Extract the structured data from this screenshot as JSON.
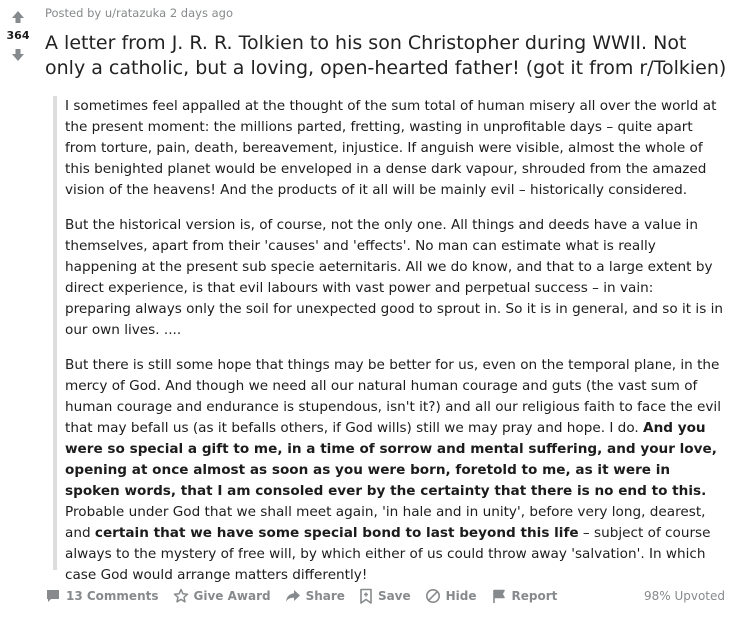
{
  "vote": {
    "count": "364"
  },
  "meta": {
    "posted_by": "Posted by u/ratazuka 2 days ago"
  },
  "post": {
    "title": "A letter from J. R. R. Tolkien to his son Christopher during WWII. Not only a catholic, but a loving, open-hearted father! (got it from r/Tolkien)",
    "paragraphs": [
      "I sometimes feel appalled at the thought of the sum total of human misery all over the world at the present moment: the millions parted, fretting, wasting in unprofitable days – quite apart from torture, pain, death, bereavement, injustice. If anguish were visible, almost the whole of this benighted planet would be enveloped in a dense dark vapour, shrouded from the amazed vision of the heavens! And the products of it all will be mainly evil – historically considered.",
      "But the historical version is, of course, not the only one. All things and deeds have a value in themselves, apart from their 'causes' and 'effects'. No man can estimate what is really happening at the present sub specie aeternitaris. All we do know, and that to a large extent by direct experience, is that evil labours with vast power and perpetual success – in vain: preparing always only the soil for unexpected good to sprout in. So it is in general, and so it is in our own lives. ...."
    ],
    "para3": {
      "part1": "But there is still some hope that things may be better for us, even on the temporal plane, in the mercy of God. And though we need all our natural human courage and guts (the vast sum of human courage and endurance is stupendous, isn't it?) and all our religious faith to face the evil that may befall us (as it befalls others, if God wills) still we may pray and hope. I do. ",
      "bold1": "And you were so special a gift to me, in a time of sorrow and mental suffering, and your love, opening at once almost as soon as you were born, foretold to me, as it were in spoken words, that I am consoled ever by the certainty that there is no end to this.",
      "part2": " Probable under God that we shall meet again, 'in hale and in unity', before very long, dearest, and ",
      "bold2": "certain that we have some special bond to last beyond this life",
      "part3": " – subject of course always to the mystery of free will, by which either of us could throw away 'salvation'. In which case God would arrange matters differently!"
    }
  },
  "actions": {
    "comments": "13 Comments",
    "give_award": "Give Award",
    "share": "Share",
    "save": "Save",
    "hide": "Hide",
    "report": "Report",
    "upvoted": "98% Upvoted"
  },
  "colors": {
    "icon": "#878a8c",
    "quote_border": "#dddddd"
  }
}
